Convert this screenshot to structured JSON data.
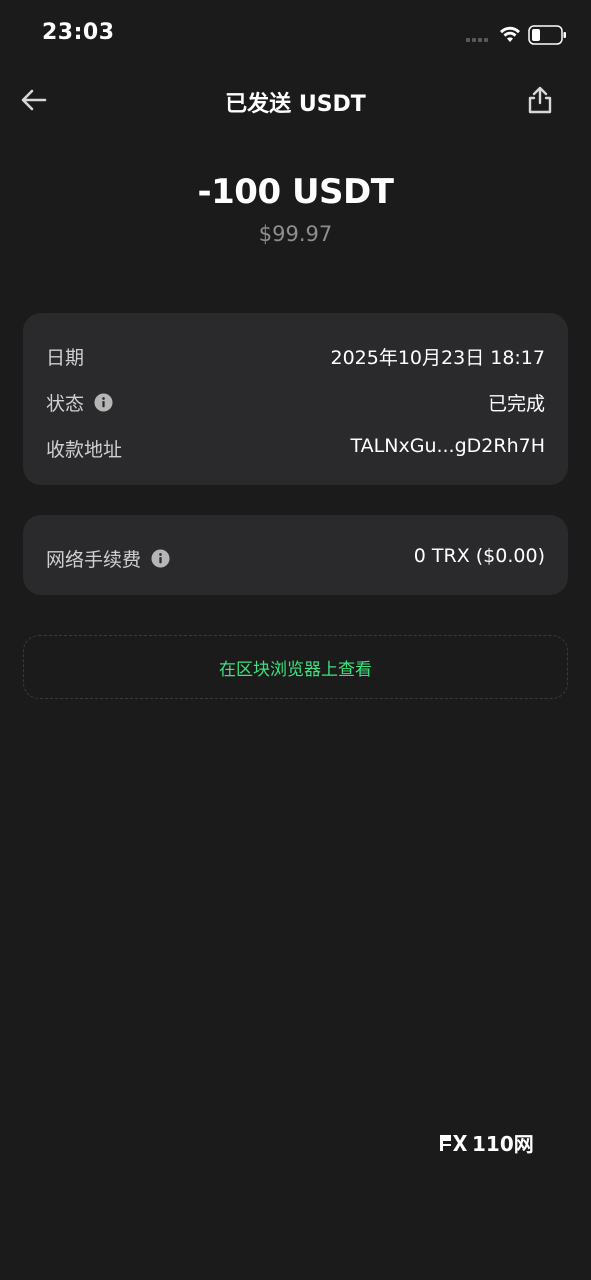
{
  "status_bar": {
    "time": "23:03"
  },
  "header": {
    "title": "已发送 USDT",
    "back_icon": "arrow-left-icon",
    "share_icon": "share-icon"
  },
  "amount": {
    "value": "-100 USDT",
    "fiat": "$99.97"
  },
  "details": {
    "rows": [
      {
        "label": "日期",
        "value": "2025年10月23日 18:17"
      },
      {
        "label": "状态",
        "value": "已完成"
      },
      {
        "label": "收款地址",
        "value": "TALNxGu...gD2Rh7H"
      }
    ]
  },
  "fee": {
    "label": "网络手续费",
    "value": "0 TRX ($0.00)"
  },
  "explorer": {
    "label": "在区块浏览器上查看"
  },
  "watermark": {
    "text": "110网"
  },
  "colors": {
    "background": "#1b1b1b",
    "card": "#2a2a2c",
    "accent_green": "#3ee07f",
    "secondary_text": "#8e8e8e"
  }
}
